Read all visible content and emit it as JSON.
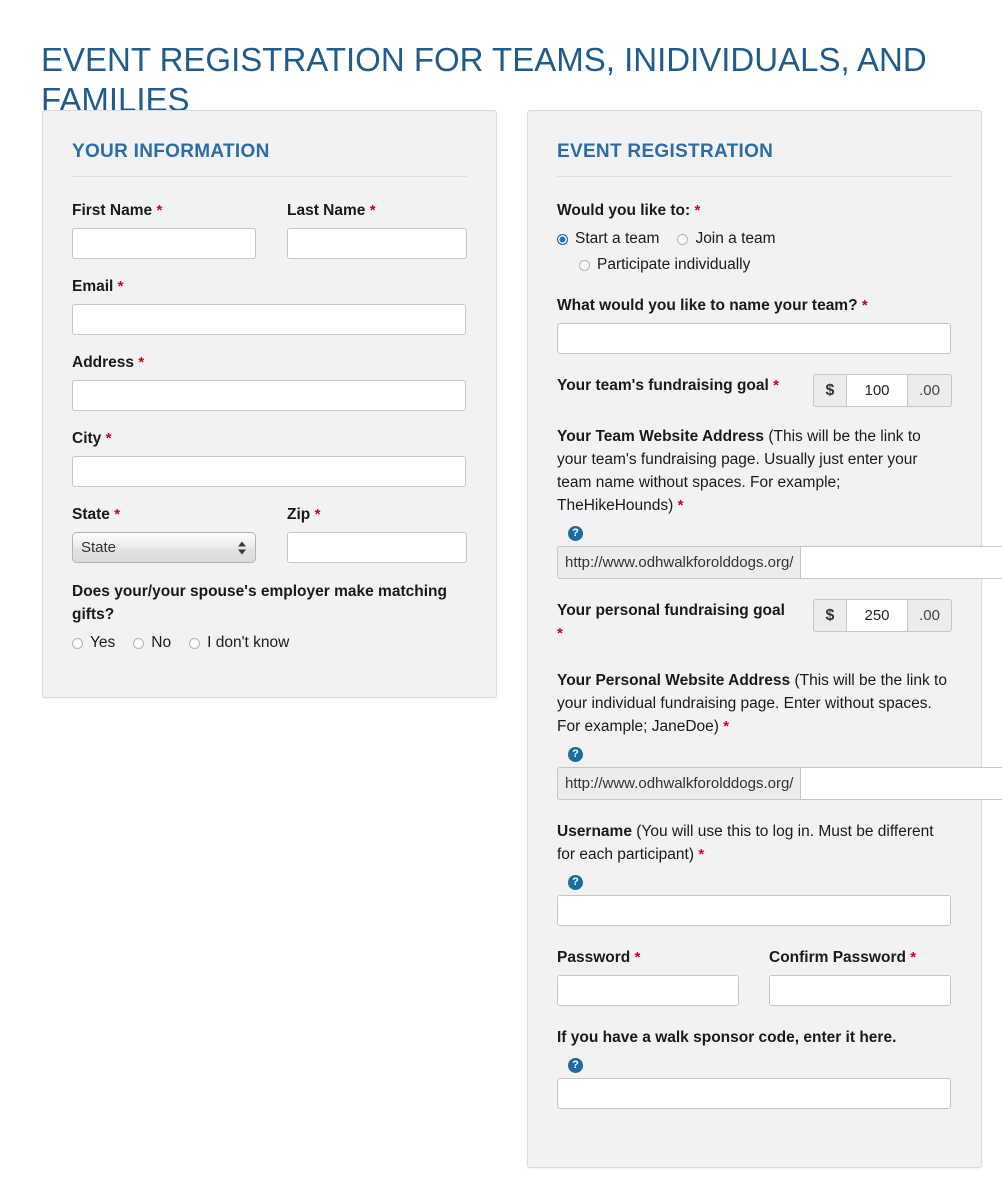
{
  "page": {
    "title": "EVENT REGISTRATION FOR TEAMS, INIDIVIDUALS, AND FAMILIES"
  },
  "colors": {
    "title_blue": "#1f5c8b",
    "heading_blue": "#2c6da8",
    "required_red": "#cc0022",
    "radio_selected": "#1675d1",
    "help_icon_blue": "#1c6a9e",
    "panel_background": "#f2f2f2"
  },
  "your_information": {
    "heading": "YOUR INFORMATION",
    "first_name": {
      "label": "First Name",
      "required": "*",
      "value": ""
    },
    "last_name": {
      "label": "Last Name",
      "required": "*",
      "value": ""
    },
    "email": {
      "label": "Email",
      "required": "*",
      "value": ""
    },
    "address": {
      "label": "Address",
      "required": "*",
      "value": ""
    },
    "city": {
      "label": "City",
      "required": "*",
      "value": ""
    },
    "state": {
      "label": "State",
      "required": "*",
      "selected": "State",
      "icon": "updown-arrows-icon"
    },
    "zip": {
      "label": "Zip",
      "required": "*",
      "value": ""
    },
    "matching_gifts": {
      "question": "Does your/your spouse's employer make matching gifts?",
      "options": [
        {
          "label": "Yes",
          "selected": false
        },
        {
          "label": "No",
          "selected": false
        },
        {
          "label": "I don't know",
          "selected": false
        }
      ]
    }
  },
  "event_registration": {
    "heading": "EVENT REGISTRATION",
    "would_you_like_to": {
      "label": "Would you like to:",
      "required": "*",
      "options_row1": [
        {
          "label": "Start a team",
          "selected": true
        },
        {
          "label": "Join a team",
          "selected": false
        }
      ],
      "options_row2": [
        {
          "label": "Participate individually",
          "selected": false
        }
      ]
    },
    "team_name": {
      "label": "What would you like to name your team?",
      "required": "*",
      "value": ""
    },
    "team_goal": {
      "label": "Your team's fundraising goal",
      "required": "*",
      "currency_symbol": "$",
      "amount": "100",
      "cents": ".00"
    },
    "team_website": {
      "label_bold": "Your Team Website Address",
      "label_note": " (This will be the link to your team's fundraising page. Usually just enter your team name without spaces. For example; TheHikeHounds)",
      "required": "*",
      "help_icon": "help-circle-icon",
      "url_prefix": "http://www.odhwalkforolddogs.org/",
      "value": ""
    },
    "personal_goal": {
      "label": "Your personal fundraising goal",
      "required": "*",
      "currency_symbol": "$",
      "amount": "250",
      "cents": ".00"
    },
    "personal_website": {
      "label_bold": "Your Personal Website Address",
      "label_note": " (This will be the link to your individual fundraising page. Enter without spaces. For example; JaneDoe)",
      "required": "*",
      "help_icon": "help-circle-icon",
      "url_prefix": "http://www.odhwalkforolddogs.org/",
      "value": ""
    },
    "username": {
      "label_bold": "Username",
      "label_note": " (You will use this to log in. Must be different for each participant)",
      "required": "*",
      "help_icon": "help-circle-icon",
      "value": ""
    },
    "password": {
      "label": "Password",
      "required": "*",
      "value": ""
    },
    "confirm_password": {
      "label": "Confirm Password",
      "required": "*",
      "value": ""
    },
    "sponsor_code": {
      "label": "If you have a walk sponsor code, enter it here.",
      "help_icon": "help-circle-icon",
      "value": ""
    }
  }
}
